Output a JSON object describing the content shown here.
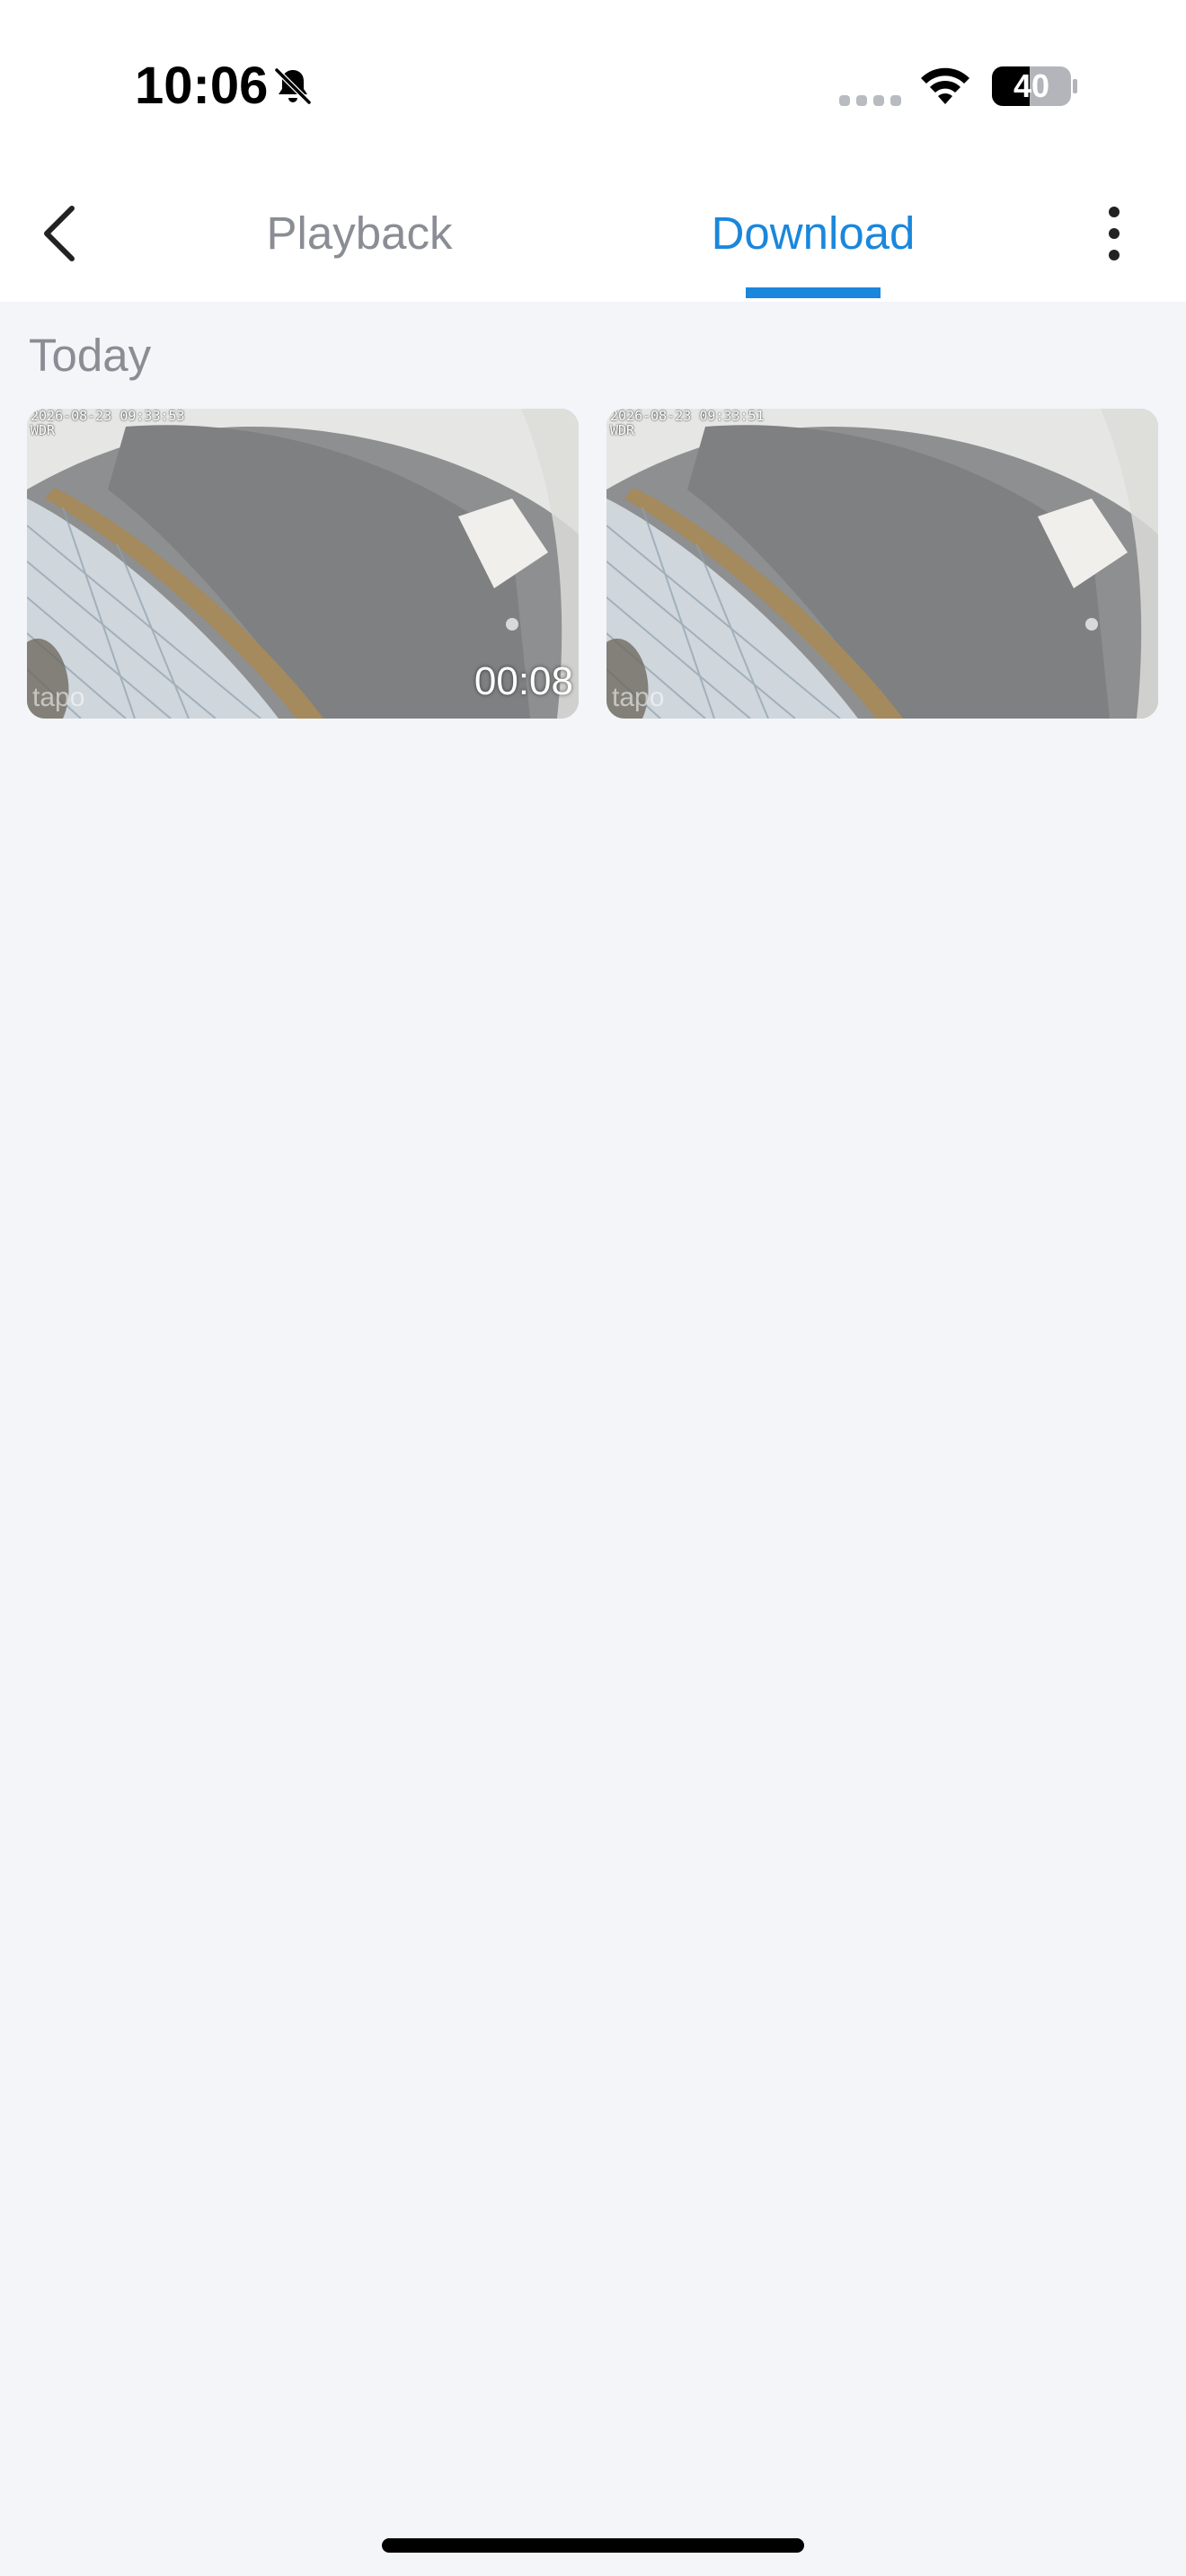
{
  "status_bar": {
    "time": "10:06",
    "battery": "40",
    "icons": [
      "bell-slash-icon",
      "signal-icon",
      "wifi-icon",
      "battery-icon"
    ]
  },
  "nav": {
    "tabs": [
      {
        "label": "Playback",
        "active": false
      },
      {
        "label": "Download",
        "active": true
      }
    ],
    "icons": [
      "chevron-left-icon",
      "more-vertical-icon"
    ],
    "colors": {
      "active": "#1a87dc",
      "inactive": "#8a8d94"
    }
  },
  "content": {
    "section_title": "Today",
    "items": [
      {
        "timestamp": "2026-08-23 09:33:53\nWDR",
        "logo": "tapo",
        "duration": "00:08"
      },
      {
        "timestamp": "2026-08-23 09:33:51\nWDR",
        "logo": "tapo",
        "duration": ""
      }
    ]
  }
}
